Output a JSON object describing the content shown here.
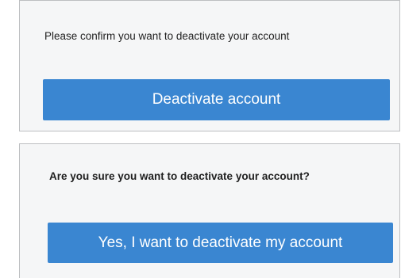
{
  "confirm_panel": {
    "prompt": "Please confirm you want to deactivate your account",
    "button_label": "Deactivate account"
  },
  "final_confirm_panel": {
    "prompt": "Are you sure you want to deactivate your account?",
    "button_label": "Yes, I want to deactivate my account"
  },
  "colors": {
    "button_bg": "#3a86d1",
    "panel_bg": "#f5f6f7",
    "panel_border": "#bdbfc1"
  }
}
